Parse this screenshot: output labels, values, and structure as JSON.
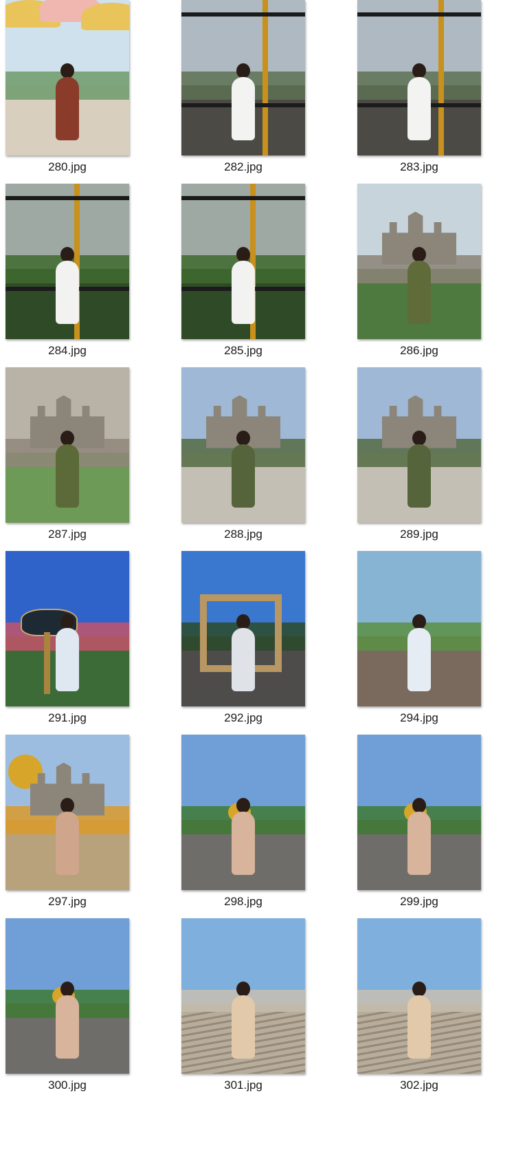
{
  "files": [
    {
      "name": "280.jpg",
      "scene": "parasols-terrace"
    },
    {
      "name": "282.jpg",
      "scene": "cable-car-cabin"
    },
    {
      "name": "283.jpg",
      "scene": "cable-car-cabin"
    },
    {
      "name": "284.jpg",
      "scene": "cable-car-forest"
    },
    {
      "name": "285.jpg",
      "scene": "cable-car-forest"
    },
    {
      "name": "286.jpg",
      "scene": "castle-closeup"
    },
    {
      "name": "287.jpg",
      "scene": "castle-railing"
    },
    {
      "name": "288.jpg",
      "scene": "castle-terrace"
    },
    {
      "name": "289.jpg",
      "scene": "castle-terrace"
    },
    {
      "name": "291.jpg",
      "scene": "garden-sign"
    },
    {
      "name": "292.jpg",
      "scene": "wooden-gate"
    },
    {
      "name": "294.jpg",
      "scene": "garden-walkway"
    },
    {
      "name": "297.jpg",
      "scene": "golden-globe-garden"
    },
    {
      "name": "298.jpg",
      "scene": "village-plaza"
    },
    {
      "name": "299.jpg",
      "scene": "village-plaza"
    },
    {
      "name": "300.jpg",
      "scene": "village-plaza"
    },
    {
      "name": "301.jpg",
      "scene": "grand-staircase"
    },
    {
      "name": "302.jpg",
      "scene": "grand-staircase"
    }
  ],
  "colors": {
    "label_text": "#1a1a1a",
    "background": "#ffffff"
  }
}
